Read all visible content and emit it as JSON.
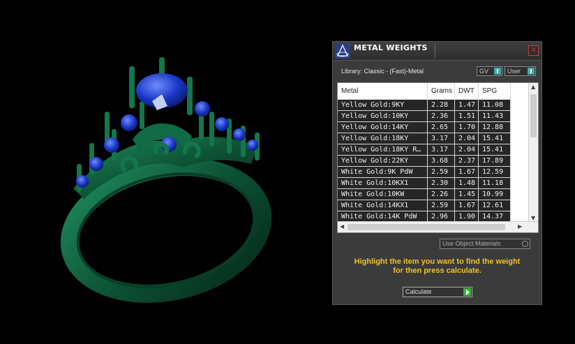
{
  "panel": {
    "title": "METAL WEIGHTS",
    "close_glyph": "✕",
    "library": "Library: Classic - (Fast)-Metal",
    "toggle_gv": "GV",
    "toggle_user": "User",
    "columns": [
      "Metal",
      "Grams",
      "DWT",
      "SPG"
    ],
    "rows": [
      [
        "Yellow Gold:9KY",
        "2.28",
        "1.47",
        "11.08"
      ],
      [
        "Yellow Gold:10KY",
        "2.36",
        "1.51",
        "11.43"
      ],
      [
        "Yellow Gold:14KY",
        "2.65",
        "1.70",
        "12.88"
      ],
      [
        "Yellow Gold:18KY",
        "3.17",
        "2.04",
        "15.41"
      ],
      [
        "Yellow Gold:18KY R…",
        "3.17",
        "2.04",
        "15.41"
      ],
      [
        "Yellow Gold:22KY",
        "3.68",
        "2.37",
        "17.89"
      ],
      [
        "White Gold:9K PdW",
        "2.59",
        "1.67",
        "12.59"
      ],
      [
        "White Gold:10KX1",
        "2.30",
        "1.48",
        "11.18"
      ],
      [
        "White Gold:10KW",
        "2.26",
        "1.45",
        "10.99"
      ],
      [
        "White Gold:14KX1",
        "2.59",
        "1.67",
        "12.61"
      ],
      [
        "White Gold:14K PdW",
        "2.96",
        "1.90",
        "14.37"
      ]
    ],
    "use_object_materials": "Use Object Materials",
    "hint_line1": "Highlight the item you want to find the weight",
    "hint_line2": "for then press calculate.",
    "calculate_label": "Calculate"
  },
  "colors": {
    "ring_metal": "#0e5a3a",
    "gem": "#1a3fd1",
    "hint": "#f3c024",
    "accent": "#44aaaa"
  }
}
